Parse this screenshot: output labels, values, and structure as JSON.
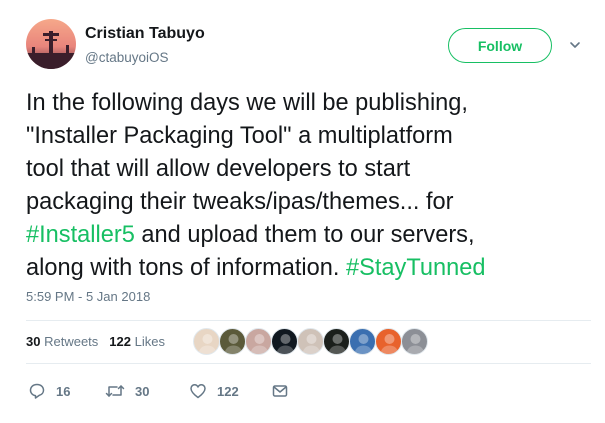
{
  "author": {
    "name": "Cristian Tabuyo",
    "handle": "@ctabuyoiOS"
  },
  "follow_label": "Follow",
  "tweet": {
    "lines": [
      [
        {
          "text": "In the following days we will be publishing,"
        }
      ],
      [
        {
          "text": "\"Installer Packaging Tool\" a multiplatform"
        }
      ],
      [
        {
          "text": "tool that will allow developers to start"
        }
      ],
      [
        {
          "text": "packaging their tweaks/ipas/themes... for"
        }
      ],
      [
        {
          "text": "#Installer5",
          "hashtag": true
        },
        {
          "text": " and upload them to our servers,"
        }
      ],
      [
        {
          "text": "along with tons of information. "
        },
        {
          "text": "#StayTunned",
          "hashtag": true
        }
      ]
    ]
  },
  "timestamp": "5:59 PM - 5 Jan 2018",
  "stats": {
    "retweets_count": "30",
    "retweets_label": "Retweets",
    "likes_count": "122",
    "likes_label": "Likes"
  },
  "likers": [
    {
      "name": "liker-1",
      "color": "#e8d6c4"
    },
    {
      "name": "liker-2",
      "color": "#5b5a3a"
    },
    {
      "name": "liker-3",
      "color": "#c9a7a0"
    },
    {
      "name": "liker-4",
      "color": "#101820"
    },
    {
      "name": "liker-5",
      "color": "#cfc2b8"
    },
    {
      "name": "liker-6",
      "color": "#1b1f1b"
    },
    {
      "name": "liker-7",
      "color": "#3a6fb0"
    },
    {
      "name": "liker-8",
      "color": "#e8622c"
    },
    {
      "name": "liker-9",
      "color": "#8c8f96"
    }
  ],
  "actions": {
    "reply_count": "16",
    "retweet_count": "30",
    "like_count": "122"
  },
  "colors": {
    "accent": "#17bf63",
    "text": "#14171a",
    "muted": "#657786",
    "divider": "#e6ecf0"
  }
}
